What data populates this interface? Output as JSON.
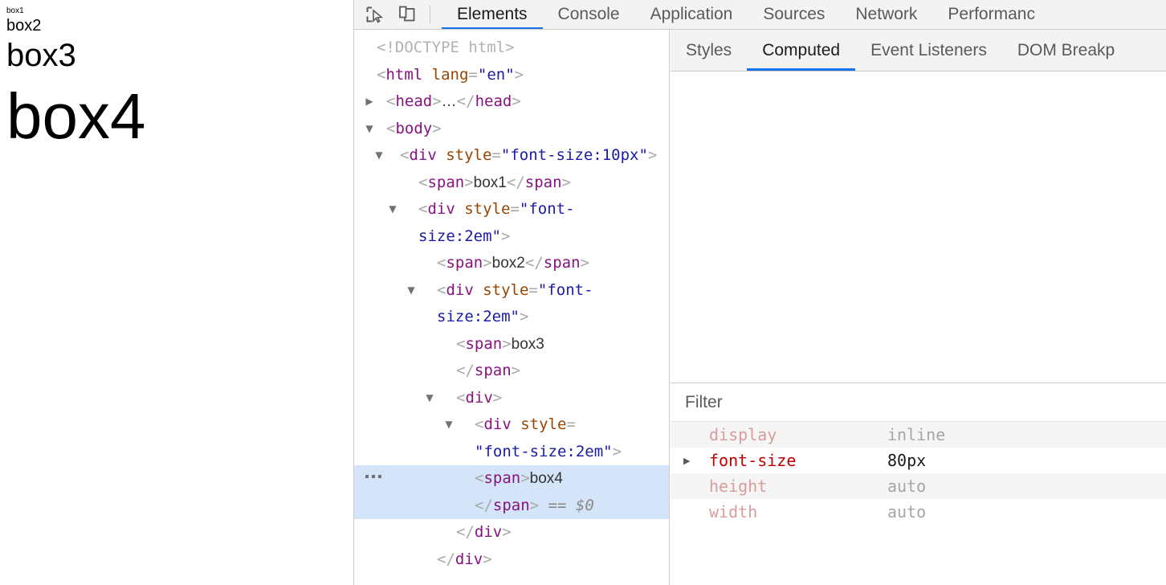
{
  "viewport": {
    "boxes": [
      {
        "label": "box1",
        "font_size_px": 10
      },
      {
        "label": "box2",
        "font_size_px": 20
      },
      {
        "label": "box3",
        "font_size_px": 40
      },
      {
        "label": "box4",
        "font_size_px": 80
      }
    ]
  },
  "devtools": {
    "toolbar": {
      "icons": [
        {
          "name": "inspect-element-icon",
          "title": "Inspect element"
        },
        {
          "name": "device-toolbar-icon",
          "title": "Toggle device toolbar"
        }
      ],
      "tabs": [
        {
          "label": "Elements",
          "active": true
        },
        {
          "label": "Console",
          "active": false
        },
        {
          "label": "Application",
          "active": false
        },
        {
          "label": "Sources",
          "active": false
        },
        {
          "label": "Network",
          "active": false
        },
        {
          "label": "Performanc",
          "active": false
        }
      ]
    },
    "dom_tree": {
      "rows": [
        {
          "twisty": "",
          "indent": 0,
          "selected": false,
          "segments": [
            {
              "cls": "c-doctype",
              "t": "<!DOCTYPE html>"
            }
          ]
        },
        {
          "twisty": "",
          "indent": 0,
          "selected": false,
          "segments": [
            {
              "cls": "c-bracket",
              "t": "<"
            },
            {
              "cls": "c-tag",
              "t": "html"
            },
            {
              "cls": "c-attr",
              "t": " lang"
            },
            {
              "cls": "c-bracket",
              "t": "="
            },
            {
              "cls": "c-val",
              "t": "\"en\""
            },
            {
              "cls": "c-bracket",
              "t": ">"
            }
          ]
        },
        {
          "twisty": "▶",
          "indent": 1,
          "selected": false,
          "segments": [
            {
              "cls": "c-bracket",
              "t": "<"
            },
            {
              "cls": "c-tag",
              "t": "head"
            },
            {
              "cls": "c-bracket",
              "t": ">"
            },
            {
              "cls": "c-text",
              "t": "…"
            },
            {
              "cls": "c-bracket",
              "t": "</"
            },
            {
              "cls": "c-tag",
              "t": "head"
            },
            {
              "cls": "c-bracket",
              "t": ">"
            }
          ]
        },
        {
          "twisty": "▼",
          "indent": 1,
          "selected": false,
          "segments": [
            {
              "cls": "c-bracket",
              "t": "<"
            },
            {
              "cls": "c-tag",
              "t": "body"
            },
            {
              "cls": "c-bracket",
              "t": ">"
            }
          ]
        },
        {
          "twisty": "▼",
          "indent": 2,
          "selected": false,
          "segments": [
            {
              "cls": "c-bracket",
              "t": "<"
            },
            {
              "cls": "c-tag",
              "t": "div"
            },
            {
              "cls": "c-attr",
              "t": " style"
            },
            {
              "cls": "c-bracket",
              "t": "="
            },
            {
              "cls": "c-val",
              "t": "\"font-size:10px\""
            },
            {
              "cls": "c-bracket",
              "t": ">"
            }
          ]
        },
        {
          "twisty": "",
          "indent": 3,
          "selected": false,
          "segments": [
            {
              "cls": "c-bracket",
              "t": "<"
            },
            {
              "cls": "c-tag",
              "t": "span"
            },
            {
              "cls": "c-bracket",
              "t": ">"
            },
            {
              "cls": "c-text",
              "t": "box1"
            },
            {
              "cls": "c-bracket",
              "t": "</"
            },
            {
              "cls": "c-tag",
              "t": "span"
            },
            {
              "cls": "c-bracket",
              "t": ">"
            }
          ]
        },
        {
          "twisty": "▼",
          "indent": 3,
          "selected": false,
          "segments": [
            {
              "cls": "c-bracket",
              "t": "<"
            },
            {
              "cls": "c-tag",
              "t": "div"
            },
            {
              "cls": "c-attr",
              "t": " style"
            },
            {
              "cls": "c-bracket",
              "t": "="
            },
            {
              "cls": "c-val",
              "t": "\"font-size:2em\""
            },
            {
              "cls": "c-bracket",
              "t": ">"
            }
          ]
        },
        {
          "twisty": "",
          "indent": 4,
          "selected": false,
          "segments": [
            {
              "cls": "c-bracket",
              "t": "<"
            },
            {
              "cls": "c-tag",
              "t": "span"
            },
            {
              "cls": "c-bracket",
              "t": ">"
            },
            {
              "cls": "c-text",
              "t": "box2"
            },
            {
              "cls": "c-bracket",
              "t": "</"
            },
            {
              "cls": "c-tag",
              "t": "span"
            },
            {
              "cls": "c-bracket",
              "t": ">"
            }
          ]
        },
        {
          "twisty": "▼",
          "indent": 4,
          "selected": false,
          "segments": [
            {
              "cls": "c-bracket",
              "t": "<"
            },
            {
              "cls": "c-tag",
              "t": "div"
            },
            {
              "cls": "c-attr",
              "t": " style"
            },
            {
              "cls": "c-bracket",
              "t": "="
            },
            {
              "cls": "c-val",
              "t": "\"font-size:2em\""
            },
            {
              "cls": "c-bracket",
              "t": ">"
            }
          ]
        },
        {
          "twisty": "",
          "indent": 5,
          "selected": false,
          "segments": [
            {
              "cls": "c-bracket",
              "t": "<"
            },
            {
              "cls": "c-tag",
              "t": "span"
            },
            {
              "cls": "c-bracket",
              "t": ">"
            },
            {
              "cls": "c-text",
              "t": "box3"
            },
            {
              "cls": "c-bracket",
              "t": "\n</"
            },
            {
              "cls": "c-tag",
              "t": "span"
            },
            {
              "cls": "c-bracket",
              "t": ">"
            }
          ]
        },
        {
          "twisty": "▼",
          "indent": 5,
          "selected": false,
          "segments": [
            {
              "cls": "c-bracket",
              "t": "<"
            },
            {
              "cls": "c-tag",
              "t": "div"
            },
            {
              "cls": "c-bracket",
              "t": ">"
            }
          ]
        },
        {
          "twisty": "▼",
          "indent": 6,
          "selected": false,
          "segments": [
            {
              "cls": "c-bracket",
              "t": "<"
            },
            {
              "cls": "c-tag",
              "t": "div"
            },
            {
              "cls": "c-attr",
              "t": " style"
            },
            {
              "cls": "c-bracket",
              "t": "="
            },
            {
              "cls": "c-val",
              "t": "\n\"font-size:2em\""
            },
            {
              "cls": "c-bracket",
              "t": ">"
            }
          ]
        },
        {
          "twisty": "",
          "indent": 6,
          "selected": true,
          "ellipsis": true,
          "segments": [
            {
              "cls": "c-bracket",
              "t": "<"
            },
            {
              "cls": "c-tag",
              "t": "span"
            },
            {
              "cls": "c-bracket",
              "t": ">"
            },
            {
              "cls": "c-text",
              "t": "box4"
            },
            {
              "cls": "c-bracket",
              "t": "\n</"
            },
            {
              "cls": "c-tag",
              "t": "span"
            },
            {
              "cls": "c-bracket",
              "t": ">"
            },
            {
              "cls": "c-eq",
              "t": " == "
            },
            {
              "cls": "c-ref",
              "t": "$0"
            }
          ]
        },
        {
          "twisty": "",
          "indent": 5,
          "selected": false,
          "segments": [
            {
              "cls": "c-bracket",
              "t": "</"
            },
            {
              "cls": "c-tag",
              "t": "div"
            },
            {
              "cls": "c-bracket",
              "t": ">"
            }
          ]
        },
        {
          "twisty": "",
          "indent": 4,
          "selected": false,
          "segments": [
            {
              "cls": "c-bracket",
              "t": "</"
            },
            {
              "cls": "c-tag",
              "t": "div"
            },
            {
              "cls": "c-bracket",
              "t": ">"
            }
          ]
        }
      ]
    },
    "sidebar": {
      "tabs": [
        {
          "label": "Styles",
          "active": false
        },
        {
          "label": "Computed",
          "active": true
        },
        {
          "label": "Event Listeners",
          "active": false
        },
        {
          "label": "DOM Breakp",
          "active": false
        }
      ],
      "filter": {
        "placeholder": "Filter",
        "value": ""
      },
      "computed_properties": [
        {
          "property": "display",
          "value": "inline",
          "own": false,
          "expandable": false
        },
        {
          "property": "font-size",
          "value": "80px",
          "own": true,
          "expandable": true
        },
        {
          "property": "height",
          "value": "auto",
          "own": false,
          "expandable": false
        },
        {
          "property": "width",
          "value": "auto",
          "own": false,
          "expandable": false
        }
      ]
    }
  },
  "colors": {
    "accent": "#1a73e8",
    "selection": "#d4e5f9",
    "toolbar_bg": "#f3f3f3",
    "border": "#cdcdcd",
    "tag": "#881280",
    "attr_name": "#994500",
    "attr_value": "#1a1aa6",
    "prop_own": "#c00000",
    "prop_inherited": "#d99d9d"
  }
}
